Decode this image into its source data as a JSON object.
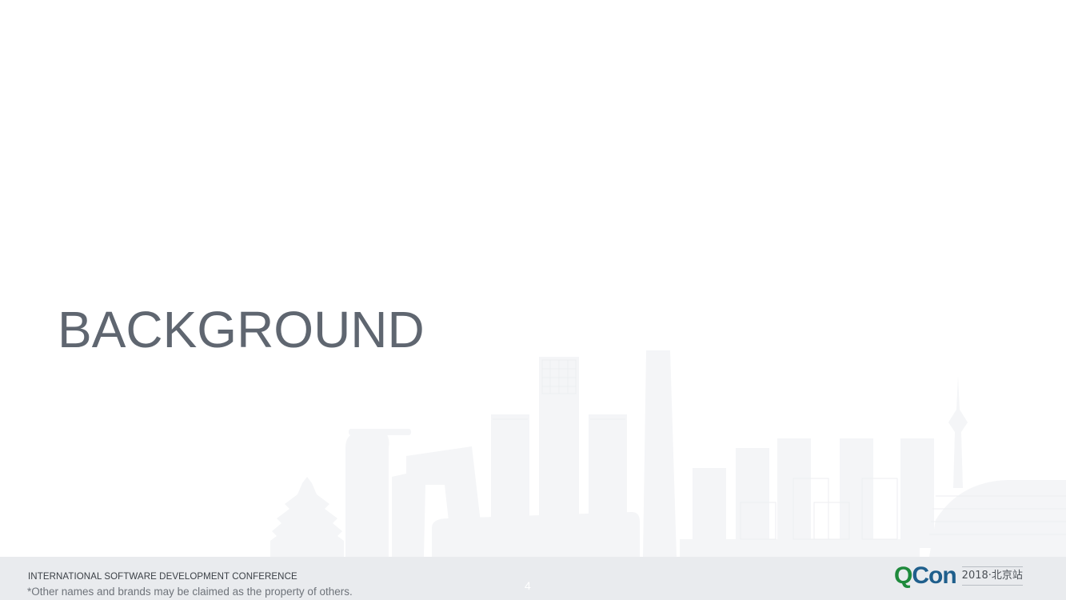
{
  "slide": {
    "title": "BACKGROUND",
    "page_number": "4"
  },
  "footer": {
    "conference_name": "INTERNATIONAL SOFTWARE DEVELOPMENT CONFERENCE",
    "disclaimer": "*Other names and brands may be claimed as the property of others.",
    "logo": {
      "brand_q": "Q",
      "brand_con": "Con",
      "edition": "2018·北京站"
    }
  },
  "colors": {
    "title": "#5f6670",
    "footer_bg": "#e9ebee",
    "skyline": "#f4f5f7",
    "brand_green": "#1e8a3c",
    "brand_blue": "#1f5f8c"
  }
}
